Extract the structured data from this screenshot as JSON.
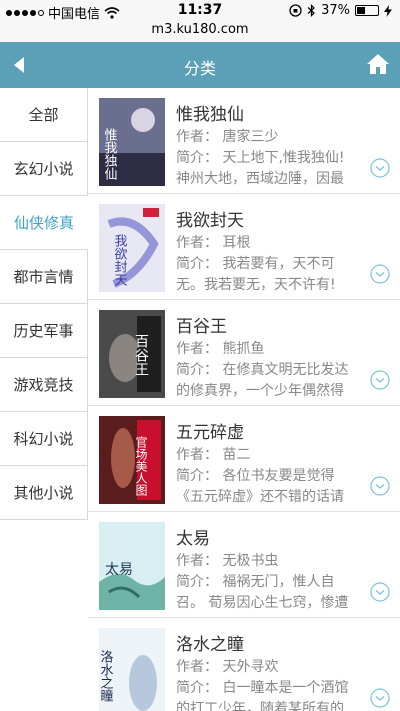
{
  "status_bar": {
    "carrier": "中国电信",
    "time": "11:37",
    "battery": "37%",
    "url": "m3.ku180.com"
  },
  "header": {
    "title": "分类",
    "back_icon": "back-arrow-icon",
    "home_icon": "home-icon"
  },
  "categories": [
    {
      "label": "全部"
    },
    {
      "label": "玄幻小说"
    },
    {
      "label": "仙侠修真",
      "active": true
    },
    {
      "label": "都市言情"
    },
    {
      "label": "历史军事"
    },
    {
      "label": "游戏竞技"
    },
    {
      "label": "科幻小说"
    },
    {
      "label": "其他小说"
    }
  ],
  "books": [
    {
      "title": "惟我独仙",
      "author": "作者：  唐家三少",
      "intro": "简介：  天上地下,惟我独仙! 神州大地，西域边陲，因最",
      "cover_text": "惟我独仙"
    },
    {
      "title": "我欲封天",
      "author": "作者：  耳根",
      "intro": "简介：  我若要有，天不可无。我若要无，天不许有!",
      "cover_text": "我欲封天"
    },
    {
      "title": "百谷王",
      "author": "作者：  熊抓鱼",
      "intro": "简介：  在修真文明无比发达的修真界，一个少年偶然得",
      "cover_text": "百谷王"
    },
    {
      "title": "五元碎虚",
      "author": "作者：  苗二",
      "intro": "简介：  各位书友要是觉得《五元碎虚》还不错的话请",
      "cover_text": "官场美人图"
    },
    {
      "title": "太易",
      "author": "作者：  无极书虫",
      "intro": "简介：  福祸无门，惟人自召。 荀易因心生七窍，惨遭",
      "cover_text": "太易"
    },
    {
      "title": "洛水之瞳",
      "author": "作者：  天外寻欢",
      "intro": "简介：  白一瞳本是一个酒馆的打工少年，随着某所有的",
      "cover_text": "洛水之瞳"
    }
  ]
}
